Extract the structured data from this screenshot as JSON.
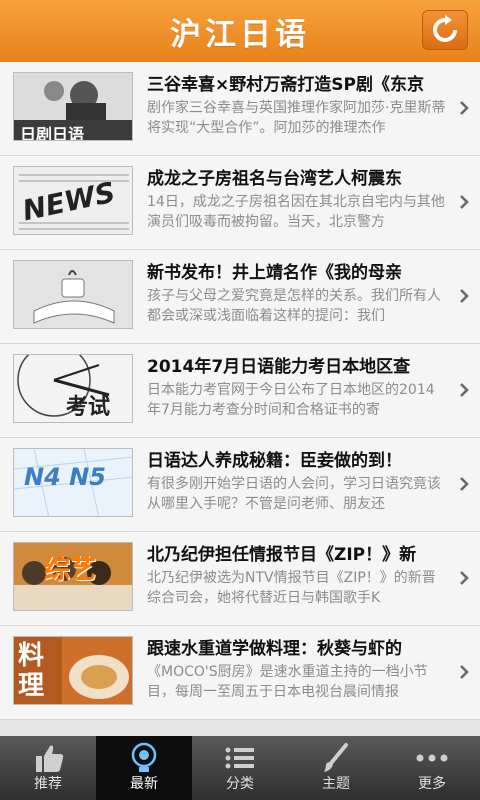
{
  "app": {
    "title": "沪江日语"
  },
  "colors": {
    "header": "#f39a2e",
    "tabbar": "#3a3a3a",
    "accent": "#ffffff"
  },
  "news": [
    {
      "title": "三谷幸喜×野村万斋打造SP剧《东京",
      "desc": "剧作家三谷幸喜与英国推理作家阿加莎·克里斯蒂将实现“大型合作”。阿加莎的推理杰作",
      "thumb_text": "日剧日语"
    },
    {
      "title": "成龙之子房祖名与台湾艺人柯震东",
      "desc": "14日，成龙之子房祖名因在其北京自宅内与其他演员们吸毒而被拘留。当天，北京警方",
      "thumb_text": "NEWS"
    },
    {
      "title": "新书发布！井上靖名作《我的母亲",
      "desc": "孩子与父母之爱究竟是怎样的关系。我们所有人都会或深或浅面临着这样的提问：我们",
      "thumb_text": ""
    },
    {
      "title": "2014年7月日语能力考日本地区查",
      "desc": "日本能力考官网于今日公布了日本地区的2014年7月能力考查分时间和合格证书的寄",
      "thumb_text": "考试"
    },
    {
      "title": "日语达人养成秘籍：臣妾做的到！",
      "desc": "有很多刚开始学日语的人会问，学习日语究竟该从哪里入手呢？不管是问老师、朋友还",
      "thumb_text": "N4 N5"
    },
    {
      "title": "北乃纪伊担任情报节目《ZIP！》新",
      "desc": "北乃纪伊被选为NTV情报节目《ZIP！》的新晋综合司会，她将代替近日与韩国歌手K",
      "thumb_text": "综艺"
    },
    {
      "title": "跟速水重道学做料理：秋葵与虾的",
      "desc": "《MOCO'S厨房》是速水重道主持的一档小节目，每周一至周五于日本电视台晨间情报",
      "thumb_text": "料理"
    }
  ],
  "tabs": [
    {
      "label": "推荐",
      "icon": "thumbs-up-icon"
    },
    {
      "label": "最新",
      "icon": "lightbulb-icon"
    },
    {
      "label": "分类",
      "icon": "list-icon"
    },
    {
      "label": "主题",
      "icon": "brush-icon"
    },
    {
      "label": "更多",
      "icon": "more-dots-icon"
    }
  ],
  "active_tab": "最新"
}
